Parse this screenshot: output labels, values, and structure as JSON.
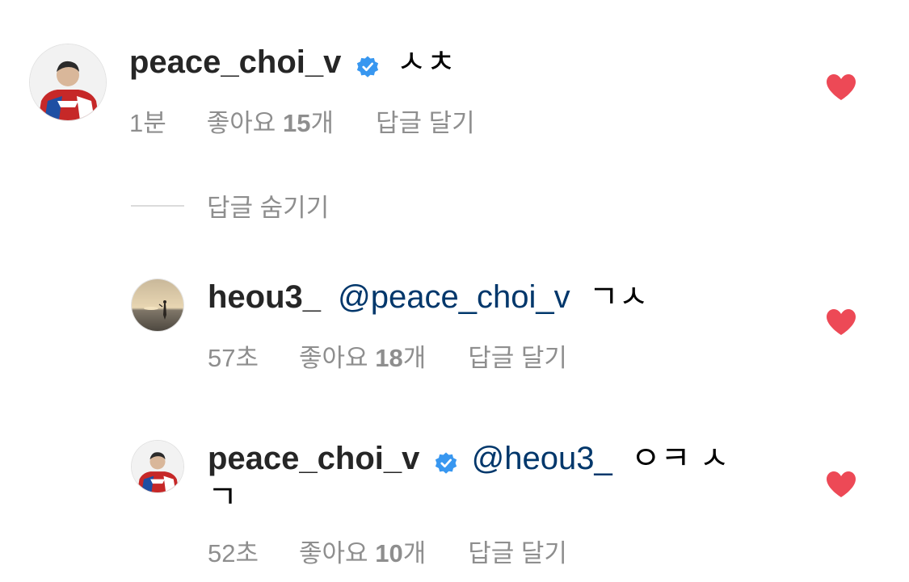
{
  "comments": [
    {
      "username": "peace_choi_v",
      "verified": true,
      "mention": "",
      "text": "ㅅㅊ",
      "time": "1분",
      "likes_prefix": "좋아요",
      "likes_count": "15",
      "likes_suffix": "개",
      "reply_label": "답글 달기",
      "liked": true
    },
    {
      "username": "heou3_",
      "verified": false,
      "mention": "@peace_choi_v",
      "text": "ㄱㅅ",
      "time": "57초",
      "likes_prefix": "좋아요",
      "likes_count": "18",
      "likes_suffix": "개",
      "reply_label": "답글 달기",
      "liked": true
    },
    {
      "username": "peace_choi_v",
      "verified": true,
      "mention": "@heou3_",
      "text": "ㅇㅋ ㅅ",
      "text_line2": "ㄱ",
      "time": "52초",
      "likes_prefix": "좋아요",
      "likes_count": "10",
      "likes_suffix": "개",
      "reply_label": "답글 달기",
      "liked": true
    }
  ],
  "hide_replies_label": "답글 숨기기",
  "colors": {
    "heart": "#ed4956",
    "verified": "#3897f0",
    "mention": "#00376b",
    "meta": "#8e8e8e"
  }
}
